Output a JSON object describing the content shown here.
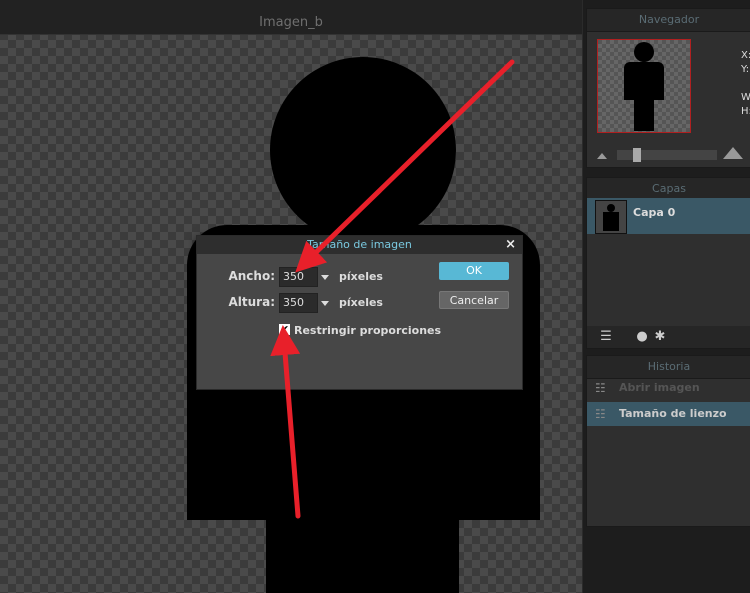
{
  "canvas": {
    "title": "Imagen_b"
  },
  "navigator": {
    "title": "Navegador",
    "readout": [
      "X:",
      "Y:",
      "W:",
      "H:"
    ]
  },
  "layers": {
    "title": "Capas",
    "items": [
      {
        "label": "Capa 0"
      }
    ]
  },
  "history": {
    "title": "Historia",
    "items": [
      {
        "label": "Abrir imagen"
      },
      {
        "label": "Tamaño de lienzo"
      }
    ]
  },
  "dialog": {
    "title": "Tamaño de imagen",
    "close": "×",
    "width_label": "Ancho:",
    "width_value": "350",
    "height_label": "Altura:",
    "height_value": "350",
    "unit": "píxeles",
    "ok_label": "OK",
    "cancel_label": "Cancelar",
    "constrain_label": "Restringir proporciones",
    "constrain_checked": true,
    "check_glyph": "✔"
  },
  "colors": {
    "accent": "#58b8d5",
    "selection": "#3a5866",
    "annotation_arrow": "#e8202a"
  }
}
